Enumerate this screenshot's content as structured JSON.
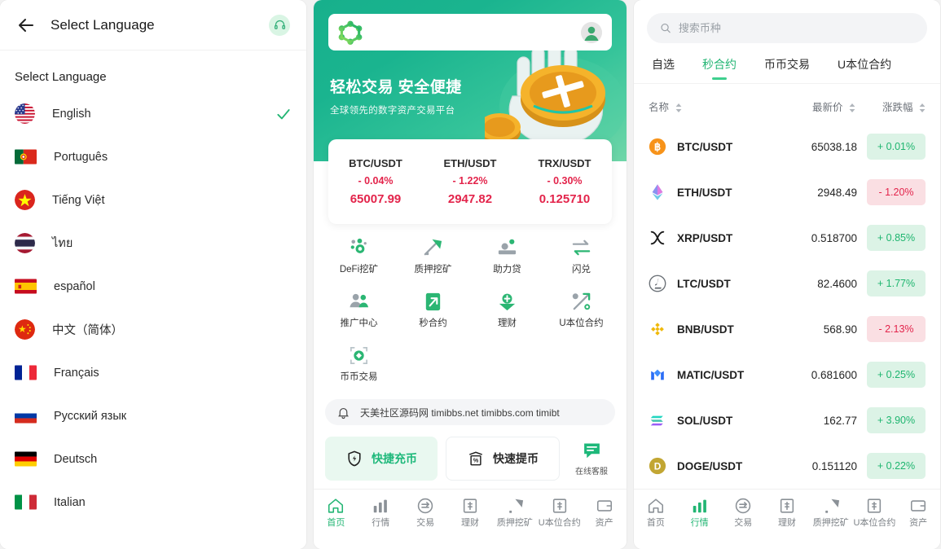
{
  "language_panel": {
    "header": {
      "back_icon": "back-arrow-icon",
      "title": "Select Language",
      "support_icon": "headset-icon"
    },
    "section_title": "Select Language",
    "items": [
      {
        "label": "English",
        "flag": "us",
        "selected": true
      },
      {
        "label": "Português",
        "flag": "pt",
        "selected": false
      },
      {
        "label": "Tiếng Việt",
        "flag": "vn",
        "selected": false
      },
      {
        "label": "ไทย",
        "flag": "th",
        "selected": false
      },
      {
        "label": "español",
        "flag": "es",
        "selected": false
      },
      {
        "label": "中文（简体）",
        "flag": "cn",
        "selected": false
      },
      {
        "label": "Français",
        "flag": "fr",
        "selected": false
      },
      {
        "label": "Русский язык",
        "flag": "ru",
        "selected": false
      },
      {
        "label": "Deutsch",
        "flag": "de",
        "selected": false
      },
      {
        "label": "Italian",
        "flag": "it",
        "selected": false
      }
    ]
  },
  "home_panel": {
    "hero": {
      "logo_icon": "molecule-logo-icon",
      "avatar_icon": "user-avatar-icon",
      "title": "轻松交易 安全便捷",
      "subtitle": "全球领先的数字资产交易平台",
      "gradient_from": "#17b08c",
      "gradient_to": "#6fd6a8"
    },
    "tickers": [
      {
        "pair": "BTC/USDT",
        "change": "- 0.04%",
        "price": "65007.99",
        "dir": "down"
      },
      {
        "pair": "ETH/USDT",
        "change": "- 1.22%",
        "price": "2947.82",
        "dir": "down"
      },
      {
        "pair": "TRX/USDT",
        "change": "- 0.30%",
        "price": "0.125710",
        "dir": "down"
      }
    ],
    "grid": [
      {
        "label": "DeFi挖矿",
        "icon": "defi-mining-icon"
      },
      {
        "label": "质押挖矿",
        "icon": "staking-mining-icon"
      },
      {
        "label": "助力贷",
        "icon": "boost-loan-icon"
      },
      {
        "label": "闪兑",
        "icon": "flash-swap-icon"
      },
      {
        "label": "推广中心",
        "icon": "promotion-center-icon"
      },
      {
        "label": "秒合约",
        "icon": "seconds-contract-icon"
      },
      {
        "label": "理财",
        "icon": "wealth-management-icon"
      },
      {
        "label": "U本位合约",
        "icon": "usdt-contract-icon"
      },
      {
        "label": "币币交易",
        "icon": "spot-trade-icon"
      }
    ],
    "notice": {
      "icon": "bell-icon",
      "text": "天美社区源码网 timibbs.net timibbs.com timibt"
    },
    "quick_actions": {
      "deposit": {
        "label": "快捷充币",
        "icon": "shield-bolt-icon"
      },
      "withdraw": {
        "label": "快速提币",
        "icon": "withdraw-printer-icon"
      },
      "support": {
        "label": "在线客服",
        "icon": "chat-bubble-icon"
      }
    },
    "bottom_nav": [
      {
        "label": "首页",
        "icon": "home-icon",
        "active": true
      },
      {
        "label": "行情",
        "icon": "market-icon",
        "active": false
      },
      {
        "label": "交易",
        "icon": "trade-icon",
        "active": false
      },
      {
        "label": "理财",
        "icon": "finance-icon",
        "active": false
      },
      {
        "label": "质押挖矿",
        "icon": "mining-icon",
        "active": false
      },
      {
        "label": "U本位合约",
        "icon": "contract-icon",
        "active": false
      },
      {
        "label": "资产",
        "icon": "assets-icon",
        "active": false
      }
    ]
  },
  "market_panel": {
    "search": {
      "icon": "search-icon",
      "placeholder": "搜索币种",
      "value": ""
    },
    "tabs": [
      {
        "label": "自选",
        "active": false
      },
      {
        "label": "秒合约",
        "active": true
      },
      {
        "label": "币币交易",
        "active": false
      },
      {
        "label": "U本位合约",
        "active": false
      }
    ],
    "columns": {
      "name": "名称",
      "price": "最新价",
      "change": "涨跌幅"
    },
    "rows": [
      {
        "symbol": "BTC/USDT",
        "icon": "btc-icon",
        "price": "65038.18",
        "change": "+ 0.01%",
        "dir": "up"
      },
      {
        "symbol": "ETH/USDT",
        "icon": "eth-icon",
        "price": "2948.49",
        "change": "- 1.20%",
        "dir": "down"
      },
      {
        "symbol": "XRP/USDT",
        "icon": "xrp-icon",
        "price": "0.518700",
        "change": "+ 0.85%",
        "dir": "up"
      },
      {
        "symbol": "LTC/USDT",
        "icon": "ltc-icon",
        "price": "82.4600",
        "change": "+ 1.77%",
        "dir": "up"
      },
      {
        "symbol": "BNB/USDT",
        "icon": "bnb-icon",
        "price": "568.90",
        "change": "- 2.13%",
        "dir": "down"
      },
      {
        "symbol": "MATIC/USDT",
        "icon": "matic-icon",
        "price": "0.681600",
        "change": "+ 0.25%",
        "dir": "up"
      },
      {
        "symbol": "SOL/USDT",
        "icon": "sol-icon",
        "price": "162.77",
        "change": "+ 3.90%",
        "dir": "up"
      },
      {
        "symbol": "DOGE/USDT",
        "icon": "doge-icon",
        "price": "0.151120",
        "change": "+ 0.22%",
        "dir": "up"
      }
    ],
    "bottom_nav": [
      {
        "label": "首页",
        "icon": "home-icon",
        "active": false
      },
      {
        "label": "行情",
        "icon": "market-icon",
        "active": true
      },
      {
        "label": "交易",
        "icon": "trade-icon",
        "active": false
      },
      {
        "label": "理财",
        "icon": "finance-icon",
        "active": false
      },
      {
        "label": "质押挖矿",
        "icon": "mining-icon",
        "active": false
      },
      {
        "label": "U本位合约",
        "icon": "contract-icon",
        "active": false
      },
      {
        "label": "资产",
        "icon": "assets-icon",
        "active": false
      }
    ]
  },
  "colors": {
    "brand_green": "#22b573",
    "up_green": "#1eb56f",
    "down_red": "#e3244b",
    "page_bg": "#f2f2f2"
  }
}
